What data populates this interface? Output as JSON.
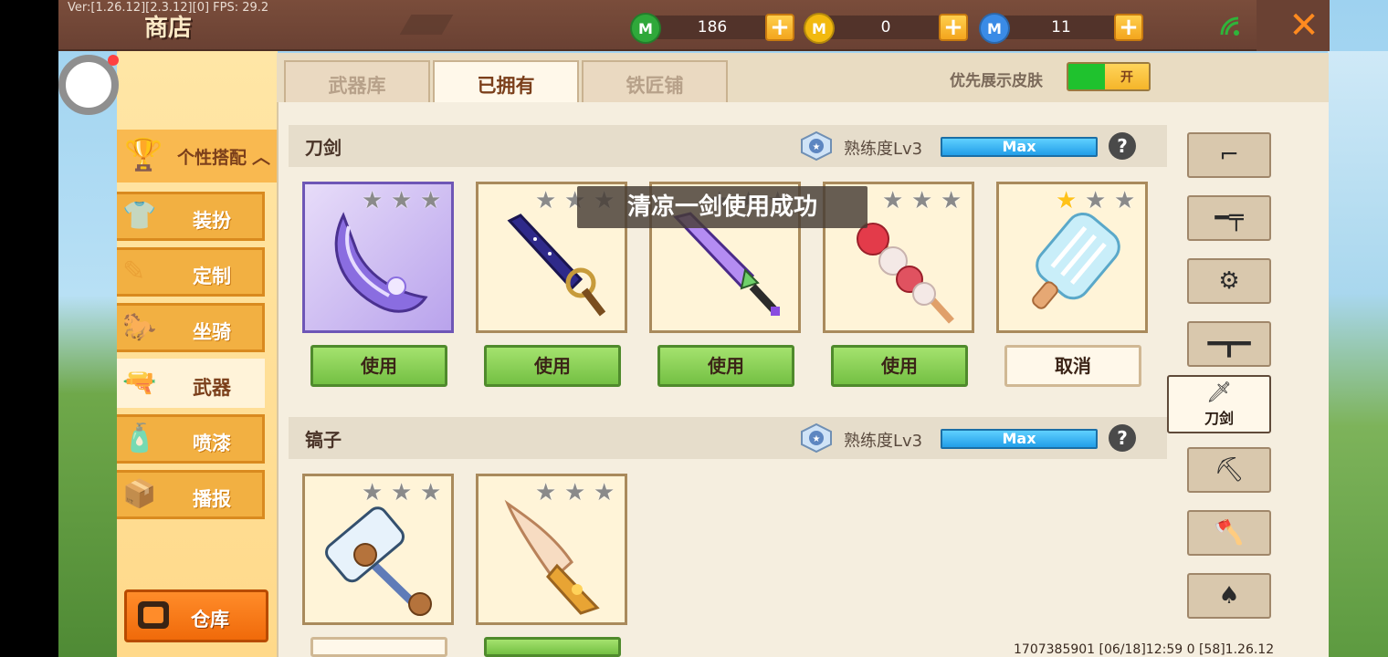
{
  "debug": {
    "version": "Ver:[1.26.12][2.3.12][0] FPS: 29.2"
  },
  "header": {
    "title": "商店",
    "currencies": [
      {
        "icon": "green-gem-icon",
        "letter": "M",
        "color": "#2fa83a",
        "value": "186"
      },
      {
        "icon": "gold-coin-icon",
        "letter": "M",
        "color": "#f2b90f",
        "value": "0"
      },
      {
        "icon": "blue-coin-icon",
        "letter": "M",
        "color": "#3a8be6",
        "value": "11"
      }
    ],
    "plus_label": "+",
    "close_label": "✕"
  },
  "sidebar": {
    "header": "个性搭配",
    "items": [
      {
        "label": "装扮",
        "icon": "shirt-icon"
      },
      {
        "label": "定制",
        "icon": "pencil-icon"
      },
      {
        "label": "坐骑",
        "icon": "mount-icon"
      },
      {
        "label": "武器",
        "icon": "gun-icon",
        "active": true
      },
      {
        "label": "喷漆",
        "icon": "spray-icon"
      },
      {
        "label": "播报",
        "icon": "broadcast-icon"
      }
    ],
    "warehouse": "仓库"
  },
  "tabs": [
    {
      "label": "武器库"
    },
    {
      "label": "已拥有",
      "active": true
    },
    {
      "label": "铁匠铺"
    }
  ],
  "prefer_skin": {
    "label": "优先展示皮肤",
    "toggle": "开"
  },
  "sections": [
    {
      "title": "刀剑",
      "level": "熟练度Lv3",
      "bar": "Max",
      "items": [
        {
          "name": "purple-blade",
          "stars": 0,
          "button": "使用"
        },
        {
          "name": "galaxy-sword",
          "stars": 0,
          "button": "使用"
        },
        {
          "name": "crystal-sword",
          "stars": 0,
          "button": "使用"
        },
        {
          "name": "candied-hawthorn",
          "stars": 0,
          "button": "使用"
        },
        {
          "name": "popsicle",
          "stars": 1,
          "button": "取消"
        }
      ]
    },
    {
      "title": "镐子",
      "level": "熟练度Lv3",
      "bar": "Max",
      "items": [
        {
          "name": "teddy-hammer",
          "stars": 0
        },
        {
          "name": "ice-cream-cone",
          "stars": 0
        }
      ]
    }
  ],
  "toast": "清凉一剑使用成功",
  "weapon_types": [
    {
      "icon": "revolver-icon"
    },
    {
      "icon": "rifle-icon"
    },
    {
      "icon": "minigun-icon"
    },
    {
      "icon": "sniper-icon"
    },
    {
      "icon": "knife-icon",
      "label": "刀剑",
      "active": true
    },
    {
      "icon": "pickaxe-icon"
    },
    {
      "icon": "axe-icon"
    },
    {
      "icon": "shovel-icon"
    }
  ],
  "footer": "1707385901    [06/18]12:59 0    [58]1.26.12"
}
